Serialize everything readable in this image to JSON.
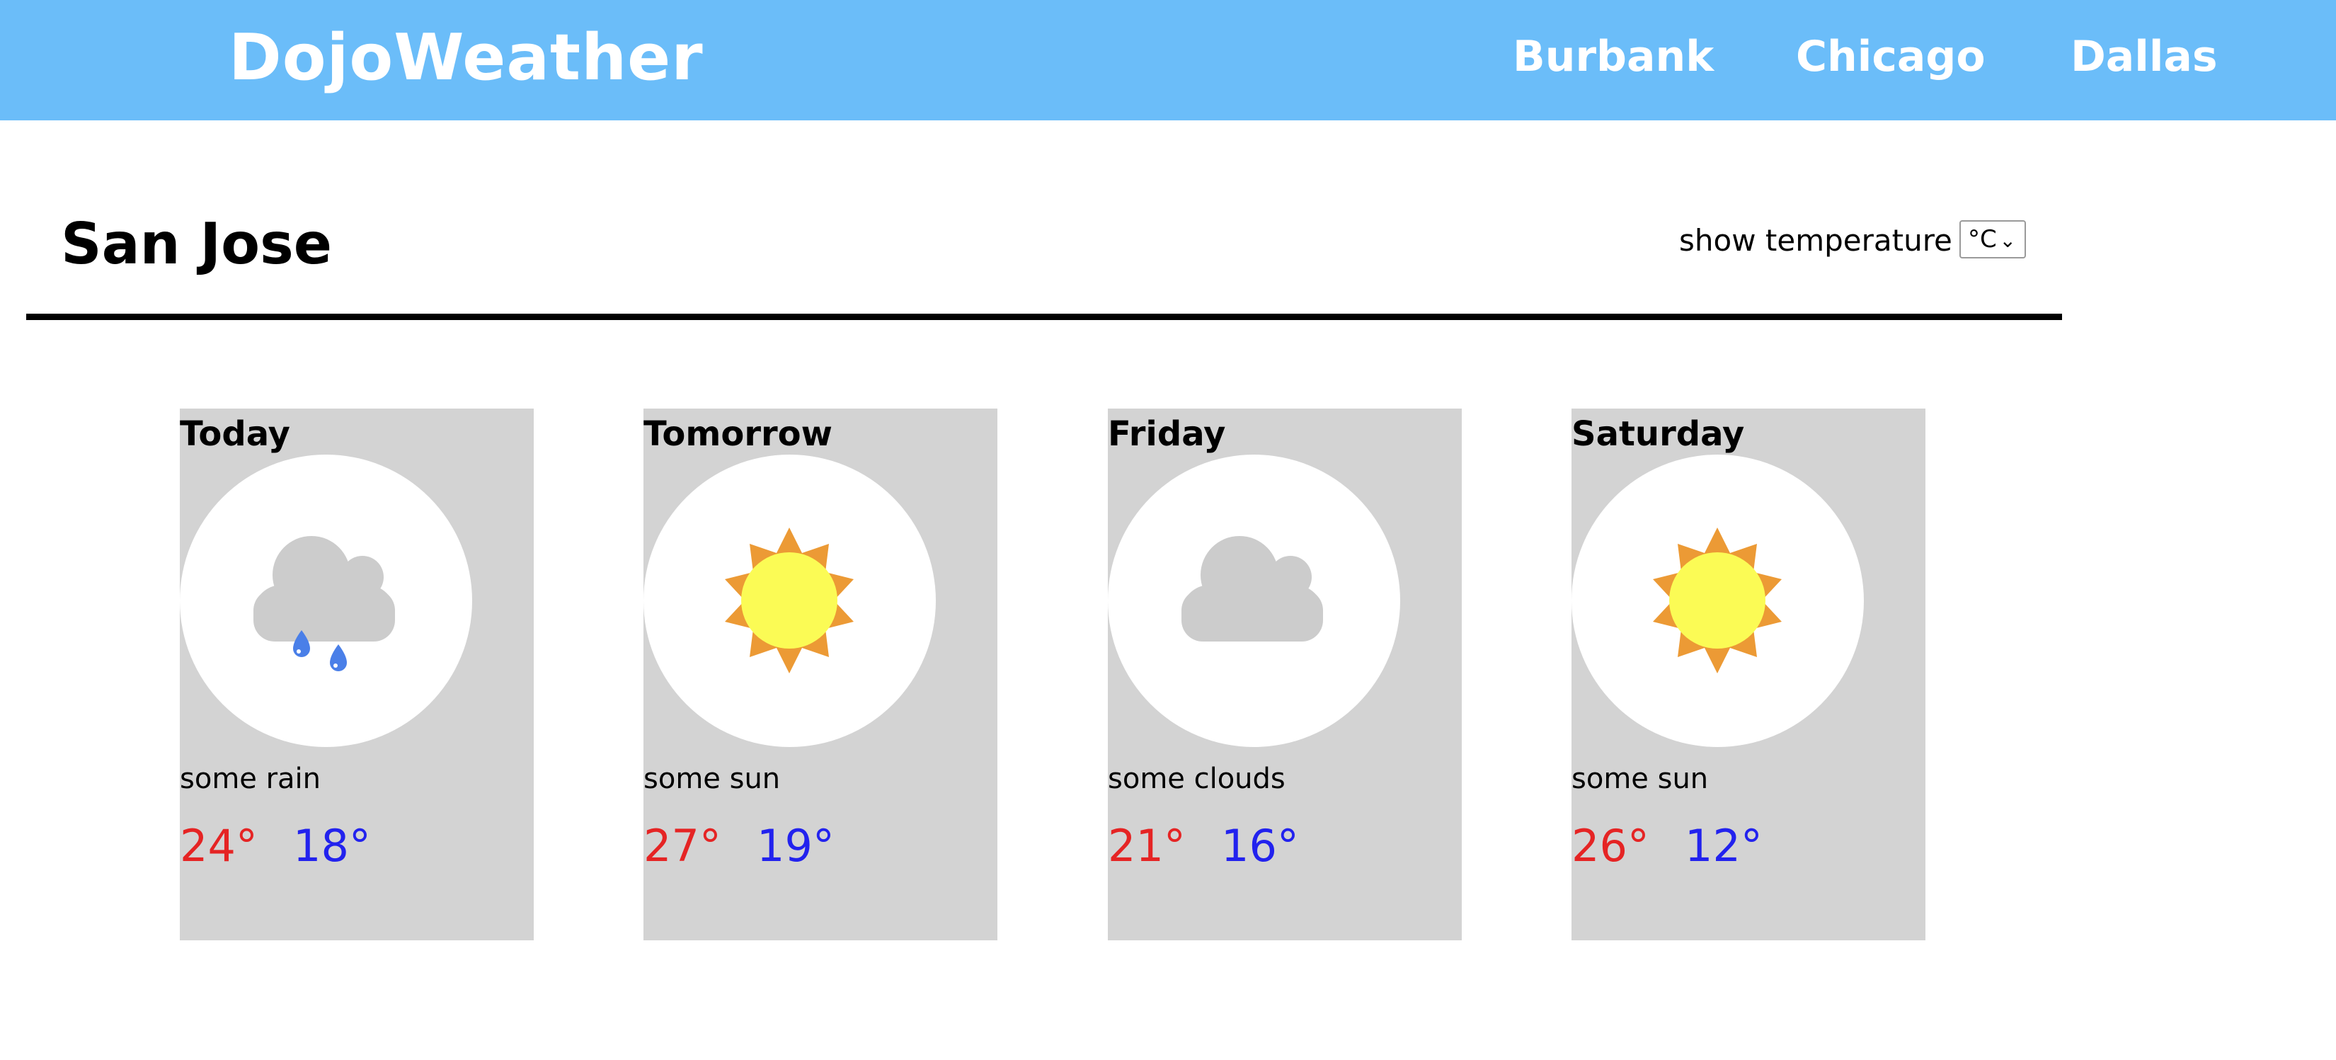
{
  "header": {
    "brand": "DojoWeather",
    "nav": [
      {
        "label": "Burbank"
      },
      {
        "label": "Chicago"
      },
      {
        "label": "Dallas"
      }
    ]
  },
  "main": {
    "city": "San Jose",
    "unit_label": "show temperature in",
    "unit_selected": "°C"
  },
  "forecast": [
    {
      "day": "Today",
      "condition": "some rain",
      "icon": "rain-cloud-icon",
      "high": "24°",
      "low": "18°"
    },
    {
      "day": "Tomorrow",
      "condition": "some sun",
      "icon": "sun-icon",
      "high": "27°",
      "low": "19°"
    },
    {
      "day": "Friday",
      "condition": "some clouds",
      "icon": "cloud-icon",
      "high": "21°",
      "low": "16°"
    },
    {
      "day": "Saturday",
      "condition": "some sun",
      "icon": "sun-icon",
      "high": "26°",
      "low": "12°"
    }
  ],
  "colors": {
    "header_bg": "#6bbdf9",
    "card_bg": "#d3d3d3",
    "high_temp": "#e52424",
    "low_temp": "#2222ee",
    "sun_rays": "#ec9a35",
    "sun_core": "#fbfb55",
    "cloud": "#cccccc",
    "rain": "#4a7fe8"
  }
}
